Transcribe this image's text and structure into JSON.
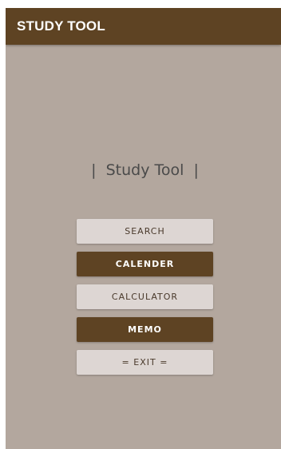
{
  "appbar": {
    "title": "STUDY TOOL"
  },
  "main": {
    "title": "|  Study Tool  |"
  },
  "menu": {
    "buttons": [
      {
        "label": "SEARCH",
        "style": "light"
      },
      {
        "label": "CALENDER",
        "style": "dark"
      },
      {
        "label": "CALCULATOR",
        "style": "light"
      },
      {
        "label": "MEMO",
        "style": "dark"
      },
      {
        "label": "= EXIT =",
        "style": "light"
      }
    ]
  },
  "colors": {
    "primary": "#5e4323",
    "background": "#b3a79e",
    "button_light": "#ddd6d3",
    "text_dark": "#4a4a4a"
  }
}
